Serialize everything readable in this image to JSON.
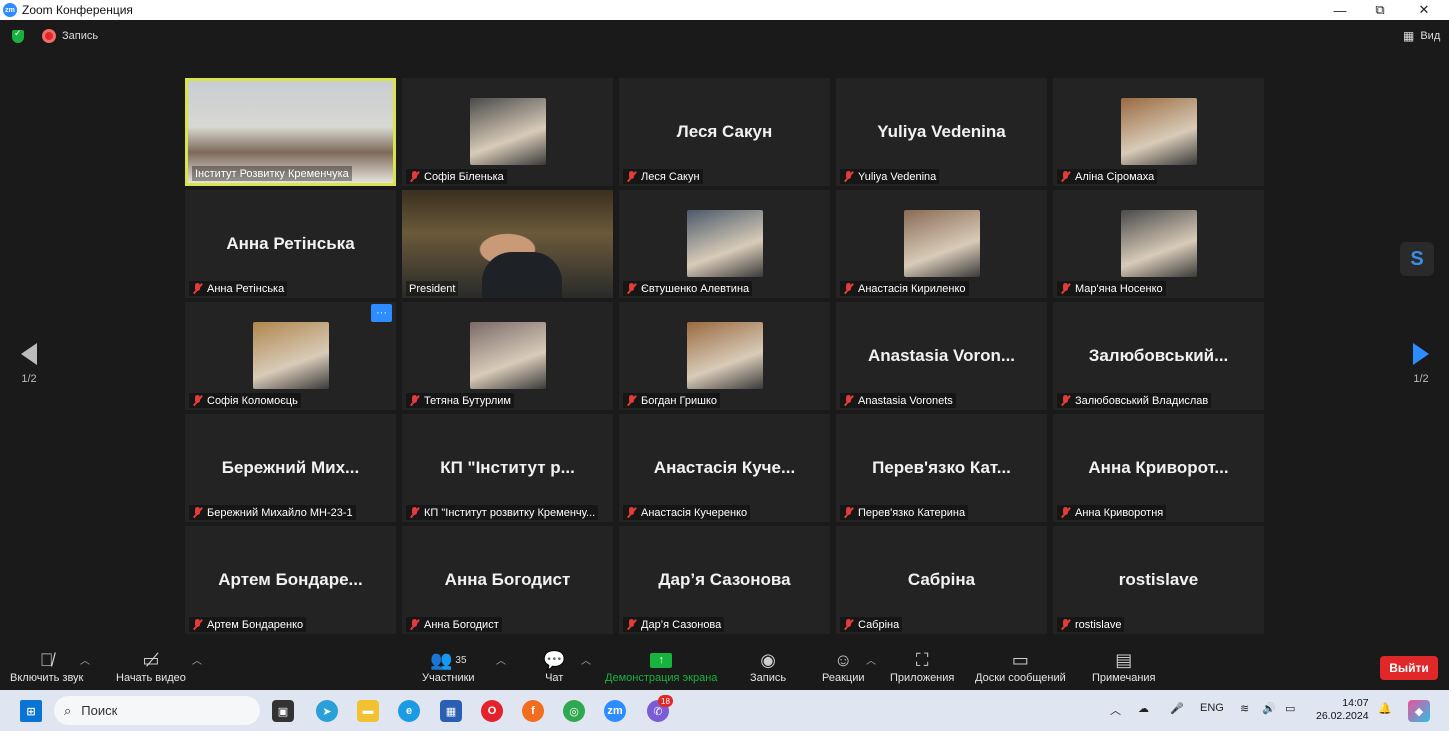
{
  "window": {
    "title": "Zoom Конференция",
    "minimize": "—",
    "maximize": "⧉",
    "close": "✕"
  },
  "topbar": {
    "record_label": "Запись",
    "view_label": "Вид"
  },
  "pager": {
    "left": "1/2",
    "right": "1/2"
  },
  "participants": [
    {
      "name": "Інститут Розвитку Кременчука",
      "big": "",
      "muted": false,
      "video": "room"
    },
    {
      "name": "Софія Біленька",
      "big": "",
      "muted": true,
      "video": "photo"
    },
    {
      "name": "Леся Сакун",
      "big": "Леся Сакун",
      "muted": true,
      "video": "none"
    },
    {
      "name": "Yuliya Vedenina",
      "big": "Yuliya Vedenina",
      "muted": true,
      "video": "none"
    },
    {
      "name": "Аліна Сіромаха",
      "big": "",
      "muted": true,
      "video": "photo"
    },
    {
      "name": "Анна Ретінська",
      "big": "Анна Ретінська",
      "muted": true,
      "video": "none"
    },
    {
      "name": "President",
      "big": "",
      "muted": false,
      "video": "person"
    },
    {
      "name": "Євтушенко Алевтина",
      "big": "",
      "muted": true,
      "video": "photo"
    },
    {
      "name": "Анастасія Кириленко",
      "big": "",
      "muted": true,
      "video": "photo"
    },
    {
      "name": "Мар'яна Носенко",
      "big": "",
      "muted": true,
      "video": "photo"
    },
    {
      "name": "Софія Коломоєць",
      "big": "",
      "muted": true,
      "video": "photo"
    },
    {
      "name": "Тетяна Бутурлим",
      "big": "",
      "muted": true,
      "video": "photo"
    },
    {
      "name": "Богдан Гришко",
      "big": "",
      "muted": true,
      "video": "photo"
    },
    {
      "name": "Anastasia Voronets",
      "big": "Anastasia Voron...",
      "muted": true,
      "video": "none"
    },
    {
      "name": "Залюбовський Владислав",
      "big": "Залюбовський...",
      "muted": true,
      "video": "none"
    },
    {
      "name": "Бережний Михайло МН-23-1",
      "big": "Бережний Мих...",
      "muted": true,
      "video": "none"
    },
    {
      "name": "КП \"Інститут розвитку Кременчу...",
      "big": "КП \"Інститут р...",
      "muted": true,
      "video": "none"
    },
    {
      "name": "Анастасія Кучеренко",
      "big": "Анастасія Куче...",
      "muted": true,
      "video": "none"
    },
    {
      "name": "Перев'язко Катерина",
      "big": "Перев'язко Кат...",
      "muted": true,
      "video": "none"
    },
    {
      "name": "Анна Криворотня",
      "big": "Анна Криворот...",
      "muted": true,
      "video": "none"
    },
    {
      "name": "Артем Бондаренко",
      "big": "Артем Бондаре...",
      "muted": true,
      "video": "none"
    },
    {
      "name": "Анна Богодист",
      "big": "Анна Богодист",
      "muted": true,
      "video": "none"
    },
    {
      "name": "Дар’я Сазонова",
      "big": "Дар’я Сазонова",
      "muted": true,
      "video": "none"
    },
    {
      "name": "Сабріна",
      "big": "Сабріна",
      "muted": true,
      "video": "none"
    },
    {
      "name": "rostislave",
      "big": "rostislave",
      "muted": true,
      "video": "none"
    }
  ],
  "toolbar": {
    "unmute": "Включить звук",
    "start_video": "Начать видео",
    "participants": "Участники",
    "participants_count": "35",
    "chat": "Чат",
    "share": "Демонстрация экрана",
    "record": "Запись",
    "reactions": "Реакции",
    "apps": "Приложения",
    "whiteboards": "Доски сообщений",
    "notes": "Примечания",
    "leave": "Выйти"
  },
  "taskbar": {
    "search_placeholder": "Поиск",
    "lang": "ENG",
    "time": "14:07",
    "date": "26.02.2024",
    "badge": "18"
  },
  "colors": {
    "accent": "#2d8cff",
    "share_green": "#18b33f",
    "leave_red": "#e02828",
    "active_border": "#d9e34a"
  }
}
